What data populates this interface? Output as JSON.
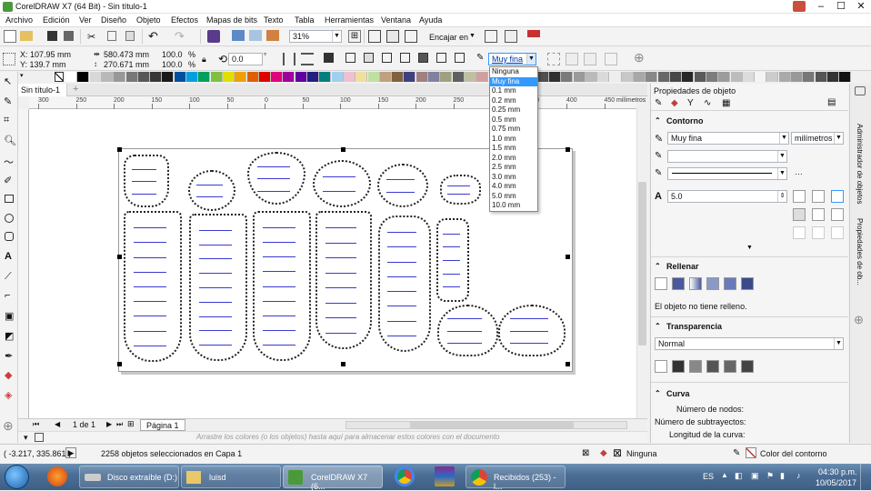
{
  "window": {
    "title": "CorelDRAW X7 (64 Bit) - Sin título-1"
  },
  "menu": [
    "Archivo",
    "Edición",
    "Ver",
    "Diseño",
    "Objeto",
    "Efectos",
    "Mapas de bits",
    "Texto",
    "Tabla",
    "Herramientas",
    "Ventana",
    "Ayuda"
  ],
  "toolbar": {
    "zoom": "31%",
    "snap_label": "Encajar en"
  },
  "propbar": {
    "x": "X: 107.95 mm",
    "y": "Y: 139.7 mm",
    "w": "580.473 mm",
    "h": "270.671 mm",
    "scale_w": "100.0",
    "scale_h": "100.0",
    "pct": "%",
    "angle": "0.0",
    "outline_width": "Muy fina"
  },
  "outline_dropdown": {
    "options": [
      "Ninguna",
      "Muy fina",
      "0.1 mm",
      "0.2 mm",
      "0.25 mm",
      "0.5 mm",
      "0.75 mm",
      "1.0 mm",
      "1.5 mm",
      "2.0 mm",
      "2.5 mm",
      "3.0 mm",
      "4.0 mm",
      "5.0 mm",
      "10.0 mm"
    ],
    "selected": "Muy fina"
  },
  "document": {
    "tab": "Sin título-1",
    "ruler_unit": "milímetros",
    "ruler_ticks": [
      "300",
      "250",
      "200",
      "150",
      "100",
      "50",
      "0",
      "50",
      "100",
      "150",
      "200",
      "250",
      "300",
      "350",
      "400",
      "450"
    ]
  },
  "pagenav": {
    "page_count": "1 de 1",
    "page_tab": "Página 1"
  },
  "palette_hint": "Arrastre los colores (o los objetos) hasta aquí para almacenar estos colores con el documento",
  "status": {
    "coords": "( -3.217, 335.861 )",
    "selection": "2258 objetos seleccionados en Capa 1",
    "fill": "Ninguna",
    "outline": "Color del contorno"
  },
  "panel": {
    "title": "Propiedades de objeto",
    "outline_section": "Contorno",
    "outline_width": "Muy fina",
    "units": "milímetros",
    "miter": "5.0",
    "fill_section": "Rellenar",
    "fill_text": "El objeto no tiene relleno.",
    "transparency_section": "Transparencia",
    "transparency_mode": "Normal",
    "curve_section": "Curva",
    "nodes_label": "Número de nodos:",
    "subpaths_label": "Número de subtrayectos:",
    "length_label": "Longitud de la curva:"
  },
  "dockers": [
    "Administrador de objetos",
    "Propiedades de ob..."
  ],
  "taskbar": {
    "items": [
      "Disco extraíble (D:)",
      "luisd",
      "CorelDRAW X7 (6...",
      "Recibidos (253) - l..."
    ],
    "lang": "ES",
    "time": "04:30 p.m.",
    "date": "10/05/2017"
  },
  "colors": {
    "accent": "#3399ff",
    "palette": [
      "#ffffff",
      "#000000",
      "#d8d8d8",
      "#b8b8b8",
      "#989898",
      "#787878",
      "#585858",
      "#383838",
      "#1a1a1a",
      "#0050a0",
      "#00a0e0",
      "#00a060",
      "#80c040",
      "#e0e000",
      "#f0a000",
      "#e06000",
      "#e00000",
      "#e0007a",
      "#a000a0",
      "#6000a0",
      "#202080",
      "#008080",
      "#a0d0f0",
      "#f0c0d0",
      "#f0e0a0",
      "#c0e0a0",
      "#c0a080",
      "#806040",
      "#404080",
      "#a08080",
      "#8080a0",
      "#a0a080",
      "#606060",
      "#c0c0a0",
      "#d0a0a0",
      "#a0c0d0",
      "#707070",
      "#909090",
      "#b0b0b0",
      "#505050",
      "#303030",
      "#7a7a7a",
      "#9a9a9a",
      "#bababa",
      "#dadada",
      "#eeeeee",
      "#c8c8c8",
      "#a8a8a8",
      "#888888",
      "#686868",
      "#484848",
      "#282828",
      "#5a5a5a",
      "#7c7c7c",
      "#9c9c9c",
      "#bcbcbc",
      "#dcdcdc",
      "#f4f4f4",
      "#cccccc",
      "#aaaaaa",
      "#999999",
      "#777777",
      "#555555",
      "#333333",
      "#111111"
    ]
  }
}
